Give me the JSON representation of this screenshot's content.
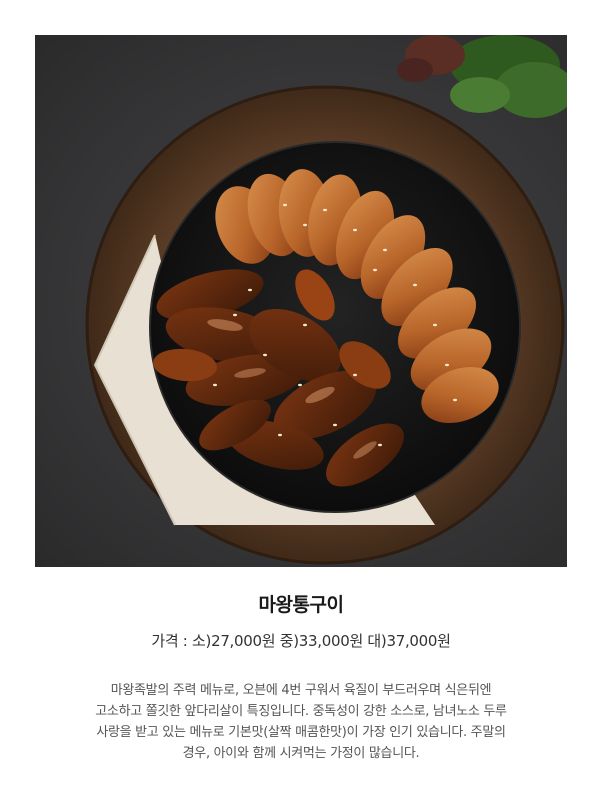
{
  "product": {
    "image_alt": "마왕통구이",
    "name": "마왕통구이",
    "price": "가격 : 소)27,000원 중)33,000원 대)37,000원",
    "description_lines": [
      "마왕족발의 주력 메뉴로, 오븐에 4번 구워서 육질이 부드러우며 식은뒤엔",
      "고소하고 쫄깃한 앞다리살이 특징입니다. 중독성이 강한 소스로, 남녀노소 두루",
      "사랑을 받고 있는 메뉴로 기본맛(살짝 매콤한맛)이 가장 인기 있습니다. 주말의",
      "경우, 아이와 함께 시켜먹는 가정이 많습니다."
    ]
  },
  "colors": {
    "background": "#3a3a3c",
    "board": "#6b4a32",
    "plate": "#151515",
    "meat": "#b8652a",
    "skin": "#8a3c12",
    "napkin": "#e8e0d2",
    "herb": "#3d6b2a"
  }
}
